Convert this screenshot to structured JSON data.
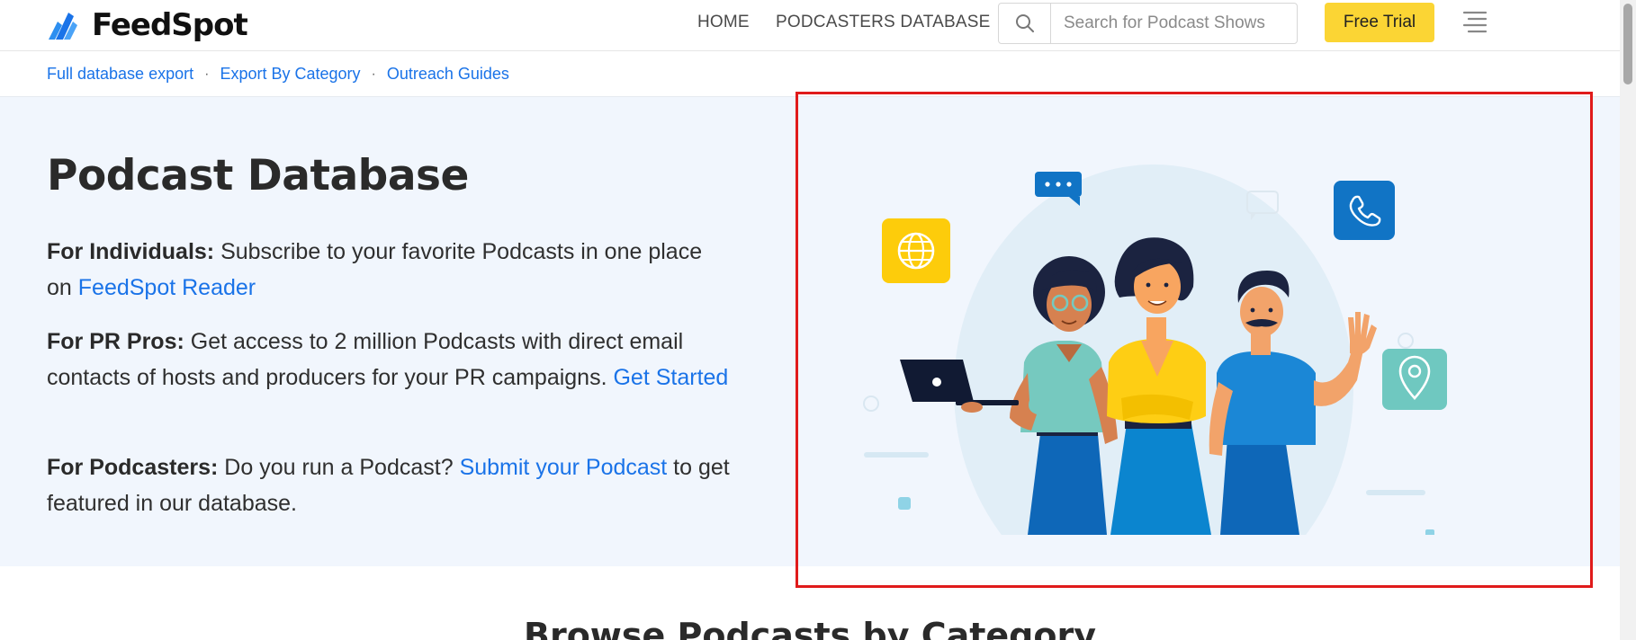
{
  "header": {
    "logo_text": "FeedSpot",
    "nav": {
      "home": "HOME",
      "podcasters_database": "PODCASTERS DATABASE"
    },
    "search": {
      "placeholder": "Search for Podcast Shows",
      "icon": "search-icon"
    },
    "free_trial": "Free Trial",
    "menu_icon": "hamburger-menu-icon"
  },
  "subnav": {
    "links": [
      "Full database export",
      "Export By Category",
      "Outreach Guides"
    ],
    "separator": "·"
  },
  "hero": {
    "title": "Podcast Database",
    "individuals": {
      "label": "For Individuals:",
      "text": " Subscribe to your favorite Podcasts in one place on ",
      "link": "FeedSpot Reader"
    },
    "pr_pros": {
      "label": "For PR Pros:",
      "text": " Get access to 2 million Podcasts with direct email contacts of hosts and producers for your PR campaigns. ",
      "link": "Get Started"
    },
    "podcasters": {
      "label": "For Podcasters:",
      "text_before": " Do you run a Podcast? ",
      "link": "Submit your Podcast",
      "text_after": " to get featured in our database."
    }
  },
  "browse_heading": "Browse Podcasts by Category",
  "colors": {
    "accent": "#1a73e8",
    "trial_button": "#fbd534",
    "hero_background": "#f1f6fd",
    "highlight": "#e01b1b"
  }
}
